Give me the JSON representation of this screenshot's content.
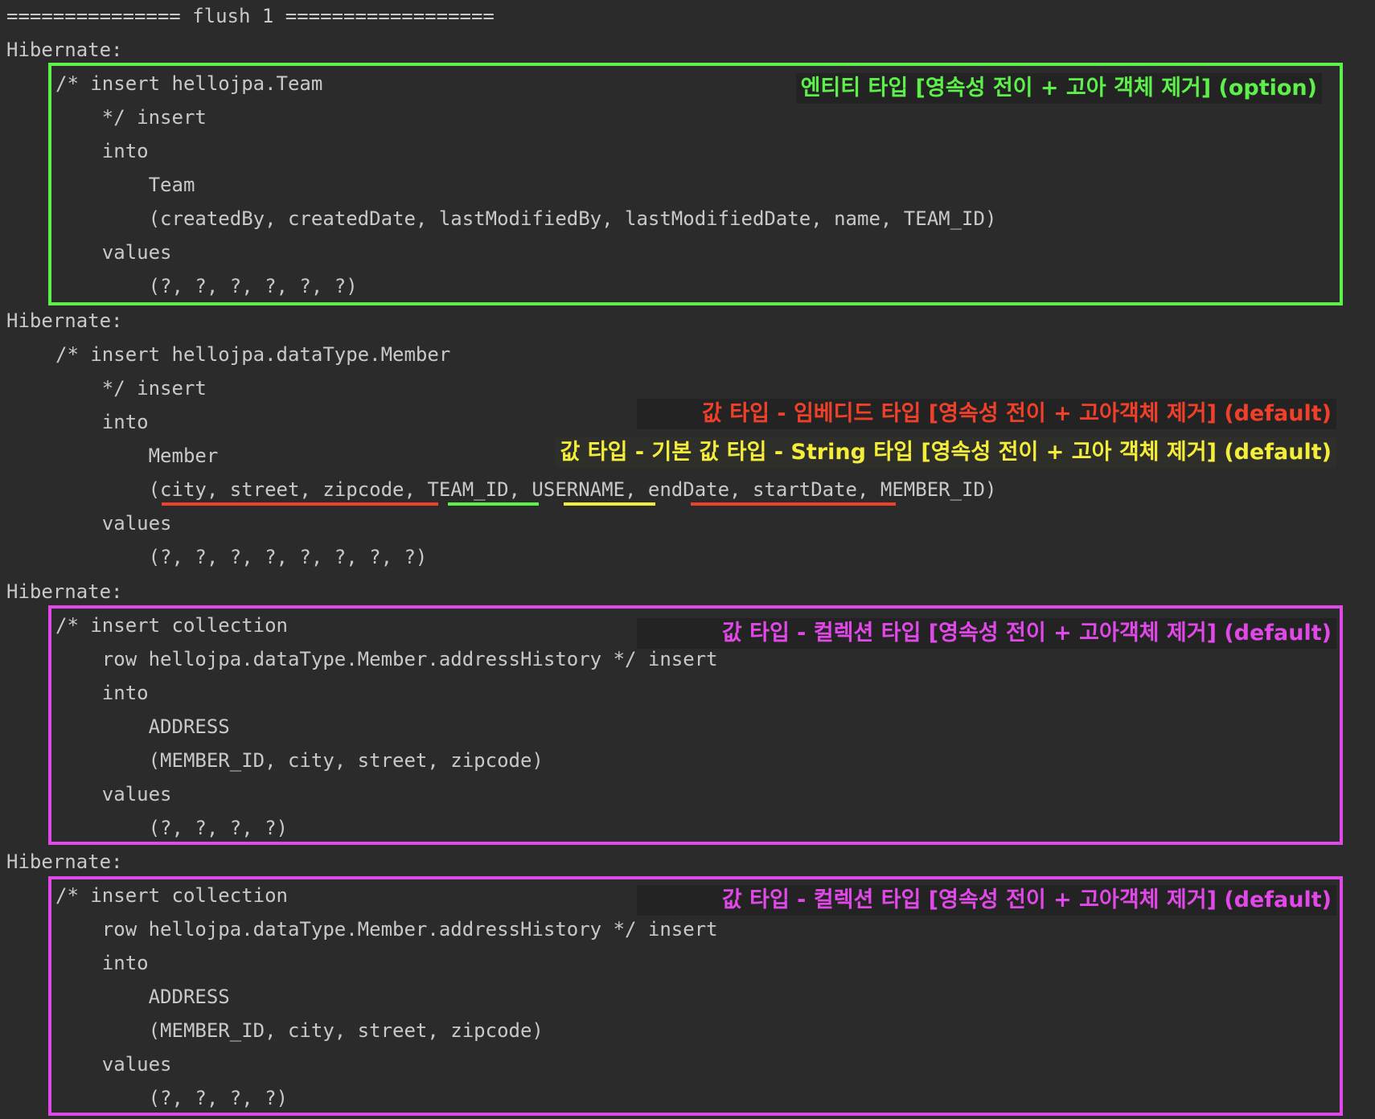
{
  "colors": {
    "background": "#2b2b2b",
    "code_text": "#c9c9c9",
    "entity_green": "#5ef04a",
    "embedded_red": "#f0402a",
    "basic_yellow": "#f4ee3a",
    "collection_magenta": "#e048e8"
  },
  "header_line": "=============== flush 1 ==================",
  "statements": [
    {
      "label": "Hibernate:",
      "lines": [
        "/* insert hellojpa.Team",
        "    */ insert",
        "    into",
        "        Team",
        "        (createdBy, createdDate, lastModifiedBy, lastModifiedDate, name, TEAM_ID)",
        "    values",
        "        (?, ?, ?, ?, ?, ?)"
      ]
    },
    {
      "label": "Hibernate:",
      "lines": [
        "/* insert hellojpa.dataType.Member",
        "    */ insert",
        "    into",
        "        Member",
        "        (city, street, zipcode, TEAM_ID, USERNAME, endDate, startDate, MEMBER_ID)",
        "    values",
        "        (?, ?, ?, ?, ?, ?, ?, ?)"
      ]
    },
    {
      "label": "Hibernate:",
      "lines": [
        "/* insert collection",
        "    row hellojpa.dataType.Member.addressHistory */ insert",
        "    into",
        "        ADDRESS",
        "        (MEMBER_ID, city, street, zipcode)",
        "    values",
        "        (?, ?, ?, ?)"
      ]
    },
    {
      "label": "Hibernate:",
      "lines": [
        "/* insert collection",
        "    row hellojpa.dataType.Member.addressHistory */ insert",
        "    into",
        "        ADDRESS",
        "        (MEMBER_ID, city, street, zipcode)",
        "    values",
        "        (?, ?, ?, ?)"
      ]
    }
  ],
  "annotations": {
    "entity_type": "엔티티 타입 [영속성 전이 + 고아 객체 제거] (option)",
    "embedded_type": "값 타입 - 임베디드 타입 [영속성 전이 + 고아객체 제거] (default)",
    "basic_type": "값 타입 - 기본 값 타입 - String 타입 [영속성 전이 + 고아 객체 제거] (default)",
    "collection_type_1": "값 타입 - 컬렉션 타입 [영속성 전이 + 고아객체 제거] (default)",
    "collection_type_2": "값 타입 - 컬렉션 타입 [영속성 전이 + 고아객체 제거] (default)"
  }
}
